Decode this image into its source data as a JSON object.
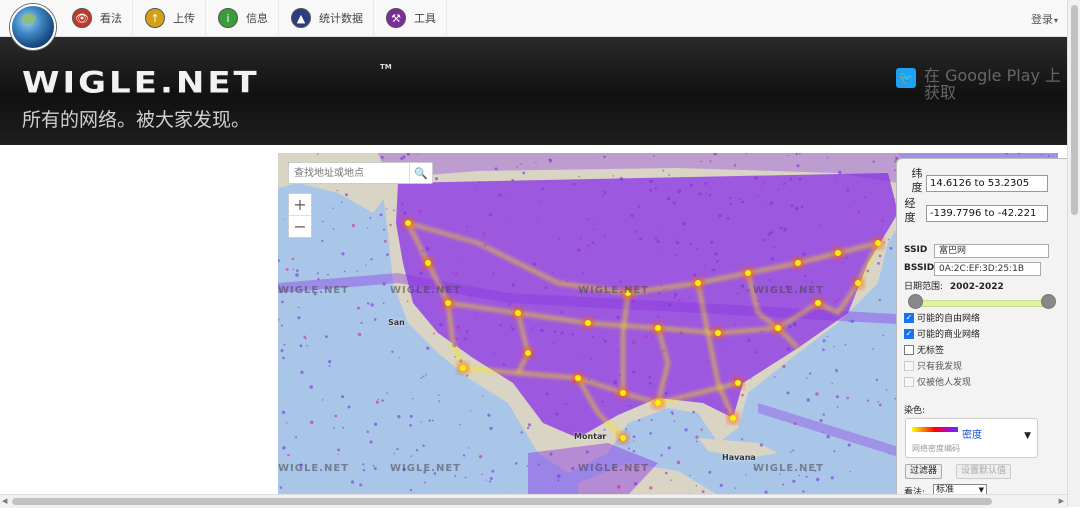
{
  "nav": {
    "items": [
      {
        "label": "看法",
        "icon": "eye-icon",
        "color": "#c0392b"
      },
      {
        "label": "上传",
        "icon": "upload-icon",
        "color": "#d4a017"
      },
      {
        "label": "信息",
        "icon": "info-icon",
        "color": "#3a9d3a"
      },
      {
        "label": "统计数据",
        "icon": "stats-icon",
        "color": "#2c3e80"
      },
      {
        "label": "工具",
        "icon": "tools-icon",
        "color": "#7b2d9a"
      }
    ],
    "login": "登录"
  },
  "banner": {
    "logo": "WIGLE.NET",
    "logo_tm": "TM",
    "slogan": "所有的网络。被大家发现。",
    "google_play": "在 Google Play 上获取"
  },
  "map": {
    "search_placeholder": "查找地址或地点",
    "watermark": "WIGLE.NET",
    "labels": {
      "san": "San",
      "montar": "Montar",
      "havana": "Havana"
    }
  },
  "panel": {
    "lat_label": "纬度",
    "lat_value": "14.6126 to 53.2305",
    "lon_label": "经度",
    "lon_value": "-139.7796 to -42.221",
    "ssid_label": "SSID",
    "ssid_value": "富巴网",
    "bssid_label": "BSSID",
    "bssid_value": "0A:2C:EF:3D:25:1B",
    "date_label": "日期范围:",
    "date_value": "2002-2022",
    "checkboxes": [
      {
        "label": "可能的自由网络",
        "checked": true,
        "disabled": false
      },
      {
        "label": "可能的商业网络",
        "checked": true,
        "disabled": false
      },
      {
        "label": "无标签",
        "checked": false,
        "disabled": false
      },
      {
        "label": "只有我发现",
        "checked": false,
        "disabled": true
      },
      {
        "label": "仅被他人发现",
        "checked": false,
        "disabled": true
      }
    ],
    "color_label": "染色:",
    "color_name": "密度",
    "color_sub": "网络密度编码",
    "filter_button": "过滤器",
    "default_button": "设置默认值",
    "view_label": "看法:",
    "view_value": "标准"
  }
}
